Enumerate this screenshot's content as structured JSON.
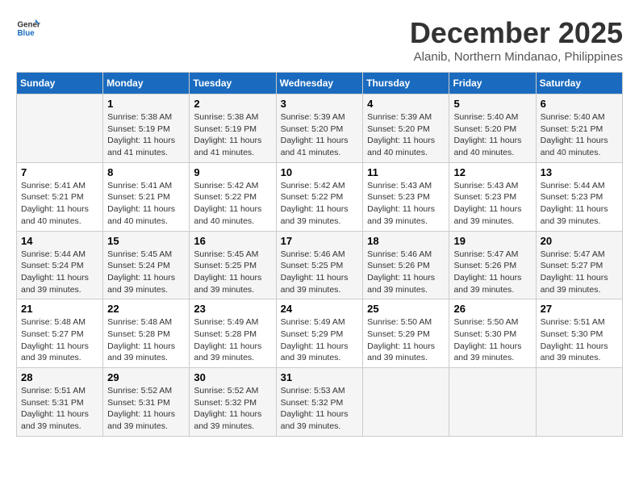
{
  "logo": {
    "text_general": "General",
    "text_blue": "Blue"
  },
  "title": "December 2025",
  "subtitle": "Alanib, Northern Mindanao, Philippines",
  "days_of_week": [
    "Sunday",
    "Monday",
    "Tuesday",
    "Wednesday",
    "Thursday",
    "Friday",
    "Saturday"
  ],
  "weeks": [
    [
      {
        "day": "",
        "info": ""
      },
      {
        "day": "1",
        "info": "Sunrise: 5:38 AM\nSunset: 5:19 PM\nDaylight: 11 hours\nand 41 minutes."
      },
      {
        "day": "2",
        "info": "Sunrise: 5:38 AM\nSunset: 5:19 PM\nDaylight: 11 hours\nand 41 minutes."
      },
      {
        "day": "3",
        "info": "Sunrise: 5:39 AM\nSunset: 5:20 PM\nDaylight: 11 hours\nand 41 minutes."
      },
      {
        "day": "4",
        "info": "Sunrise: 5:39 AM\nSunset: 5:20 PM\nDaylight: 11 hours\nand 40 minutes."
      },
      {
        "day": "5",
        "info": "Sunrise: 5:40 AM\nSunset: 5:20 PM\nDaylight: 11 hours\nand 40 minutes."
      },
      {
        "day": "6",
        "info": "Sunrise: 5:40 AM\nSunset: 5:21 PM\nDaylight: 11 hours\nand 40 minutes."
      }
    ],
    [
      {
        "day": "7",
        "info": "Sunrise: 5:41 AM\nSunset: 5:21 PM\nDaylight: 11 hours\nand 40 minutes."
      },
      {
        "day": "8",
        "info": "Sunrise: 5:41 AM\nSunset: 5:21 PM\nDaylight: 11 hours\nand 40 minutes."
      },
      {
        "day": "9",
        "info": "Sunrise: 5:42 AM\nSunset: 5:22 PM\nDaylight: 11 hours\nand 40 minutes."
      },
      {
        "day": "10",
        "info": "Sunrise: 5:42 AM\nSunset: 5:22 PM\nDaylight: 11 hours\nand 39 minutes."
      },
      {
        "day": "11",
        "info": "Sunrise: 5:43 AM\nSunset: 5:23 PM\nDaylight: 11 hours\nand 39 minutes."
      },
      {
        "day": "12",
        "info": "Sunrise: 5:43 AM\nSunset: 5:23 PM\nDaylight: 11 hours\nand 39 minutes."
      },
      {
        "day": "13",
        "info": "Sunrise: 5:44 AM\nSunset: 5:23 PM\nDaylight: 11 hours\nand 39 minutes."
      }
    ],
    [
      {
        "day": "14",
        "info": "Sunrise: 5:44 AM\nSunset: 5:24 PM\nDaylight: 11 hours\nand 39 minutes."
      },
      {
        "day": "15",
        "info": "Sunrise: 5:45 AM\nSunset: 5:24 PM\nDaylight: 11 hours\nand 39 minutes."
      },
      {
        "day": "16",
        "info": "Sunrise: 5:45 AM\nSunset: 5:25 PM\nDaylight: 11 hours\nand 39 minutes."
      },
      {
        "day": "17",
        "info": "Sunrise: 5:46 AM\nSunset: 5:25 PM\nDaylight: 11 hours\nand 39 minutes."
      },
      {
        "day": "18",
        "info": "Sunrise: 5:46 AM\nSunset: 5:26 PM\nDaylight: 11 hours\nand 39 minutes."
      },
      {
        "day": "19",
        "info": "Sunrise: 5:47 AM\nSunset: 5:26 PM\nDaylight: 11 hours\nand 39 minutes."
      },
      {
        "day": "20",
        "info": "Sunrise: 5:47 AM\nSunset: 5:27 PM\nDaylight: 11 hours\nand 39 minutes."
      }
    ],
    [
      {
        "day": "21",
        "info": "Sunrise: 5:48 AM\nSunset: 5:27 PM\nDaylight: 11 hours\nand 39 minutes."
      },
      {
        "day": "22",
        "info": "Sunrise: 5:48 AM\nSunset: 5:28 PM\nDaylight: 11 hours\nand 39 minutes."
      },
      {
        "day": "23",
        "info": "Sunrise: 5:49 AM\nSunset: 5:28 PM\nDaylight: 11 hours\nand 39 minutes."
      },
      {
        "day": "24",
        "info": "Sunrise: 5:49 AM\nSunset: 5:29 PM\nDaylight: 11 hours\nand 39 minutes."
      },
      {
        "day": "25",
        "info": "Sunrise: 5:50 AM\nSunset: 5:29 PM\nDaylight: 11 hours\nand 39 minutes."
      },
      {
        "day": "26",
        "info": "Sunrise: 5:50 AM\nSunset: 5:30 PM\nDaylight: 11 hours\nand 39 minutes."
      },
      {
        "day": "27",
        "info": "Sunrise: 5:51 AM\nSunset: 5:30 PM\nDaylight: 11 hours\nand 39 minutes."
      }
    ],
    [
      {
        "day": "28",
        "info": "Sunrise: 5:51 AM\nSunset: 5:31 PM\nDaylight: 11 hours\nand 39 minutes."
      },
      {
        "day": "29",
        "info": "Sunrise: 5:52 AM\nSunset: 5:31 PM\nDaylight: 11 hours\nand 39 minutes."
      },
      {
        "day": "30",
        "info": "Sunrise: 5:52 AM\nSunset: 5:32 PM\nDaylight: 11 hours\nand 39 minutes."
      },
      {
        "day": "31",
        "info": "Sunrise: 5:53 AM\nSunset: 5:32 PM\nDaylight: 11 hours\nand 39 minutes."
      },
      {
        "day": "",
        "info": ""
      },
      {
        "day": "",
        "info": ""
      },
      {
        "day": "",
        "info": ""
      }
    ]
  ]
}
